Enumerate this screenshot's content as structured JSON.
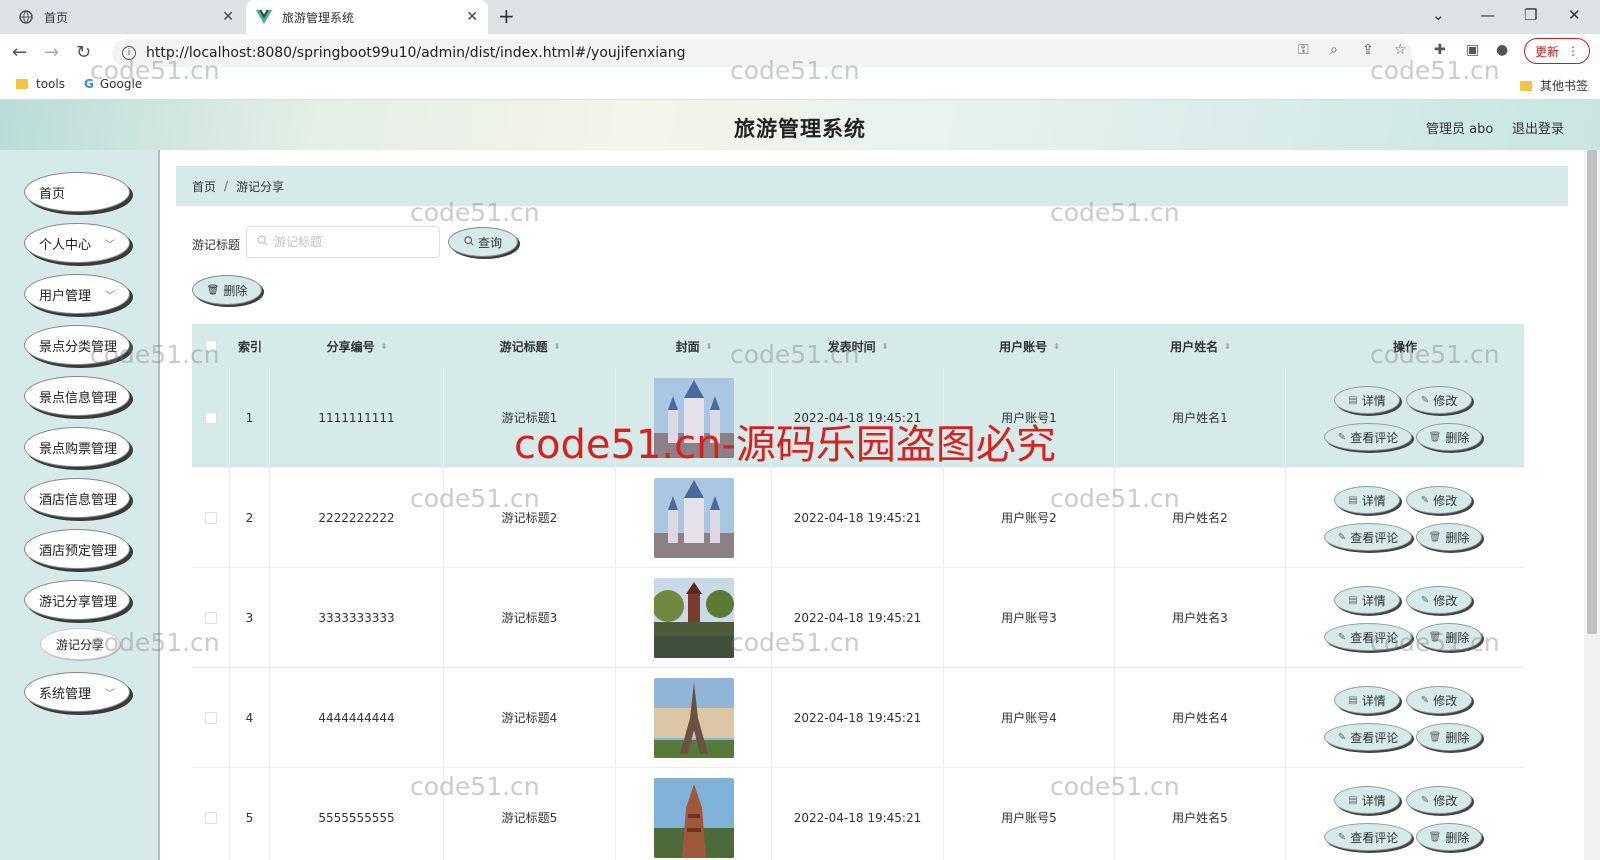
{
  "browser": {
    "tabs": [
      {
        "label": "首页",
        "icon": "globe-icon"
      },
      {
        "label": "旅游管理系统",
        "icon": "vue-logo-icon"
      }
    ],
    "url": "http://localhost:8080/springboot99u10/admin/dist/index.html#/youjifenxiang",
    "update_label": "更新",
    "bookmarks": [
      {
        "label": "tools",
        "icon": "folder-icon"
      },
      {
        "label": "Google",
        "icon": "google-icon"
      }
    ],
    "other_bookmarks": "其他书签"
  },
  "header": {
    "title": "旅游管理系统",
    "admin": "管理员 abo",
    "logout": "退出登录"
  },
  "sidebar": {
    "items": [
      {
        "label": "首页"
      },
      {
        "label": "个人中心"
      },
      {
        "label": "用户管理"
      },
      {
        "label": "景点分类管理"
      },
      {
        "label": "景点信息管理"
      },
      {
        "label": "景点购票管理"
      },
      {
        "label": "酒店信息管理"
      },
      {
        "label": "酒店预定管理"
      },
      {
        "label": "游记分享管理"
      },
      {
        "label": "游记分享"
      },
      {
        "label": "系统管理"
      }
    ]
  },
  "breadcrumb": {
    "home": "首页",
    "separator": "/",
    "current": "游记分享"
  },
  "search": {
    "label": "游记标题",
    "placeholder": "游记标题",
    "query_button": "查询"
  },
  "toolbar": {
    "delete_button": "删除"
  },
  "table": {
    "columns": [
      "索引",
      "分享编号",
      "游记标题",
      "封面",
      "发表时间",
      "用户账号",
      "用户姓名",
      "操作"
    ],
    "rows": [
      {
        "index": "1",
        "share_no": "1111111111",
        "title": "游记标题1",
        "time": "2022-04-18 19:45:21",
        "account": "用户账号1",
        "name": "用户姓名1"
      },
      {
        "index": "2",
        "share_no": "2222222222",
        "title": "游记标题2",
        "time": "2022-04-18 19:45:21",
        "account": "用户账号2",
        "name": "用户姓名2"
      },
      {
        "index": "3",
        "share_no": "3333333333",
        "title": "游记标题3",
        "time": "2022-04-18 19:45:21",
        "account": "用户账号3",
        "name": "用户姓名3"
      },
      {
        "index": "4",
        "share_no": "4444444444",
        "title": "游记标题4",
        "time": "2022-04-18 19:45:21",
        "account": "用户账号4",
        "name": "用户姓名4"
      },
      {
        "index": "5",
        "share_no": "5555555555",
        "title": "游记标题5",
        "time": "2022-04-18 19:45:21",
        "account": "用户账号5",
        "name": "用户姓名5"
      }
    ],
    "actions": {
      "detail": "详情",
      "edit": "修改",
      "comment": "查看评论",
      "delete": "删除"
    }
  },
  "watermark": {
    "small": "code51.cn",
    "big": "code51.cn-源码乐园盗图必究"
  },
  "colors": {
    "accent": "#d6eaea",
    "sidebar_border": "#9dc7c4",
    "watermark_red": "#d9201c"
  }
}
